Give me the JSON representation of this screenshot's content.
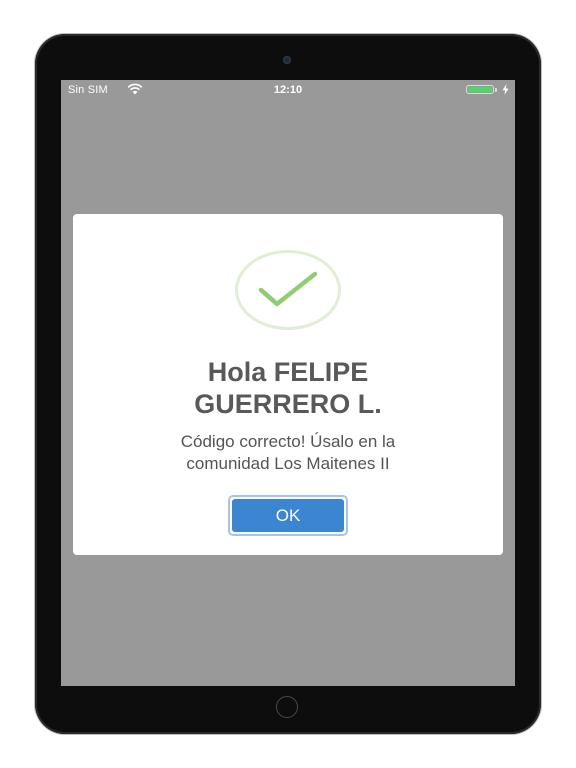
{
  "status_bar": {
    "carrier": "Sin SIM",
    "time": "12:10",
    "wifi_icon": "wifi-icon",
    "battery_icon": "battery-icon",
    "battery_level": 1.0,
    "charging_icon": "charging-bolt-icon"
  },
  "dialog": {
    "icon": "checkmark-success-icon",
    "title_line1": "Hola FELIPE",
    "title_line2": "GUERRERO L.",
    "message_line1": "Código correcto! Úsalo en la",
    "message_line2": "comunidad Los Maitenes II",
    "ok_label": "OK"
  },
  "colors": {
    "overlay": "#999999",
    "check": "#8fce72",
    "ring": "#dfeed4",
    "button": "#3b85d3",
    "button_border": "#a9c4e8",
    "title_text": "#595959",
    "battery": "#4cd964"
  }
}
